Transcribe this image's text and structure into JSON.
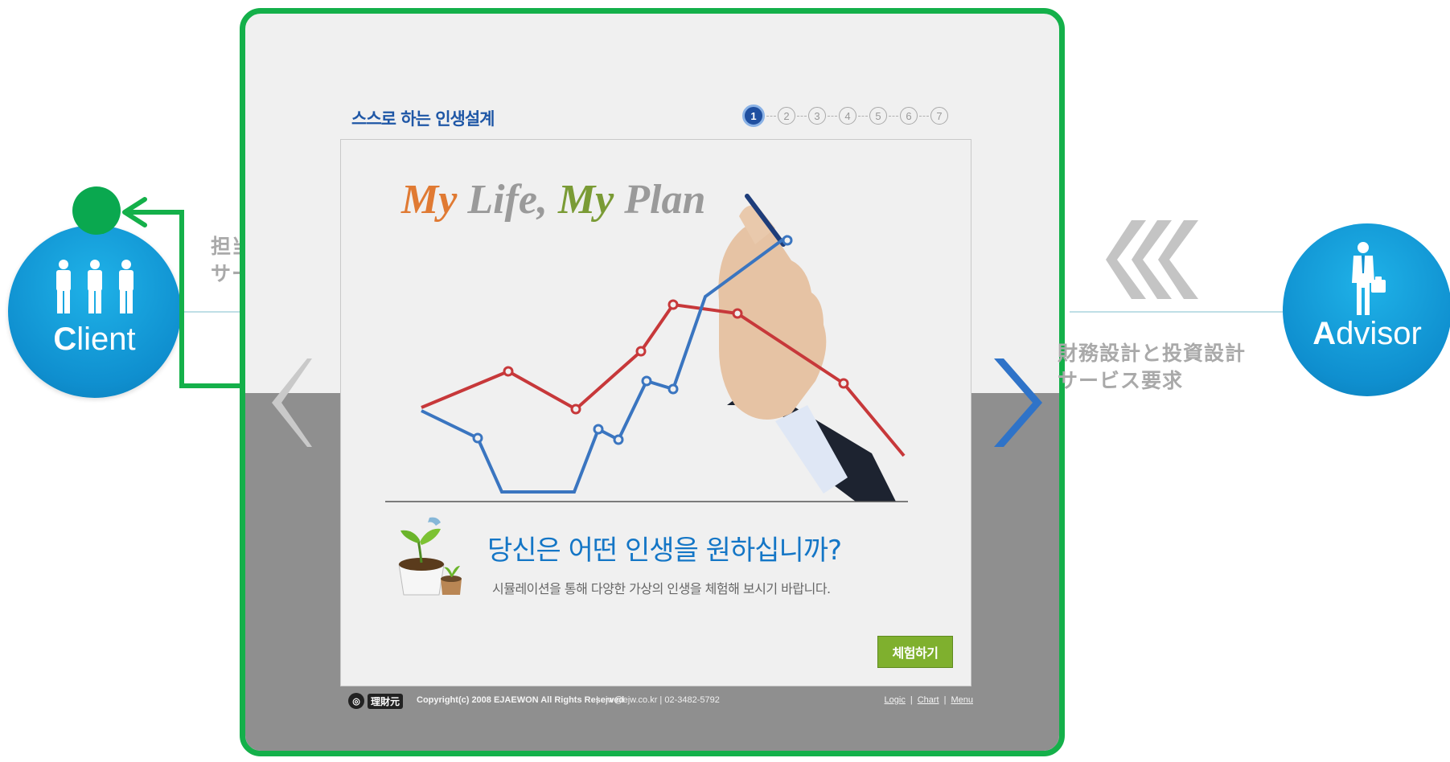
{
  "client": {
    "label_bold": "C",
    "label_rest": "lient",
    "note_line1": "担当FPの指定",
    "note_line2": "サービス要求"
  },
  "advisor": {
    "label_bold": "A",
    "label_rest": "dvisor",
    "note_line1": "財務設計と投資設計",
    "note_line2": "サービス要求"
  },
  "page": {
    "title": "스스로 하는 인생설계",
    "steps": [
      "1",
      "2",
      "3",
      "4",
      "5",
      "6",
      "7"
    ],
    "active_step": 1,
    "headline_my1": "My",
    "headline_life": "Life,",
    "headline_my2": "My",
    "headline_plan": "Plan",
    "question": "당신은 어떤 인생을 원하십니까?",
    "question_sub": "시뮬레이션을 통해 다양한 가상의 인생을 체험해 보시기 바랍니다.",
    "try_button": "체험하기"
  },
  "footer": {
    "logo_mark": "◎",
    "logo_text": "理財元",
    "copyright": "Copyright(c) 2008 EJAEWON All Rights Reserved",
    "contact": "|  ejw@ejw.co.kr  |  02-3482-5792",
    "links": [
      "Logic",
      "Chart",
      "Menu"
    ],
    "separator": "|"
  },
  "colors": {
    "frame": "#14b04a",
    "circle": "#0f8fcf",
    "title": "#1f57a6",
    "red_line": "#c7383a",
    "blue_line": "#3a75c0",
    "button": "#7fb02e"
  },
  "icons": [
    "people-icon",
    "businessman-icon",
    "plant-icon",
    "left-arrow-icon",
    "right-arrow-icon",
    "double-chevron-icon"
  ]
}
